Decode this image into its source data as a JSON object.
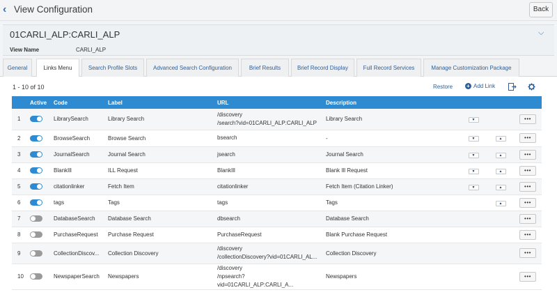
{
  "header": {
    "title": "View Configuration",
    "back_label": "Back"
  },
  "view": {
    "code": "01CARLI_ALP:CARLI_ALP",
    "name_label": "View Name",
    "name_value": "CARLI_ALP"
  },
  "tabs": [
    {
      "label": "General",
      "active": false
    },
    {
      "label": "Links Menu",
      "active": true
    },
    {
      "label": "Search Profile Slots",
      "active": false
    },
    {
      "label": "Advanced Search Configuration",
      "active": false
    },
    {
      "label": "Brief Results",
      "active": false
    },
    {
      "label": "Brief Record Display",
      "active": false
    },
    {
      "label": "Full Record Services",
      "active": false
    },
    {
      "label": "Manage Customization Package",
      "active": false
    }
  ],
  "toolbar": {
    "count": "1 - 10 of 10",
    "restore_label": "Restore",
    "add_link_label": "Add Link",
    "export_icon": "export-icon",
    "settings_icon": "gear-icon"
  },
  "table": {
    "columns": [
      "",
      "Active",
      "Code",
      "Label",
      "URL",
      "Description"
    ],
    "rows": [
      {
        "num": "1",
        "active": true,
        "code": "LibrarySearch",
        "label": "Library Search",
        "url": "/discovery\n/search?vid=01CARLI_ALP:CARLI_ALP",
        "description": "Library Search",
        "down": true,
        "up": false
      },
      {
        "num": "2",
        "active": true,
        "code": "BrowseSearch",
        "label": "Browse Search",
        "url": "bsearch",
        "description": "-",
        "down": true,
        "up": true
      },
      {
        "num": "3",
        "active": true,
        "code": "JournalSearch",
        "label": "Journal Search",
        "url": "jsearch",
        "description": "Journal Search",
        "down": true,
        "up": true
      },
      {
        "num": "4",
        "active": true,
        "code": "BlankIll",
        "label": "ILL Request",
        "url": "BlankIll",
        "description": "Blank Ill Request",
        "down": true,
        "up": true
      },
      {
        "num": "5",
        "active": true,
        "code": "citationlinker",
        "label": "Fetch Item",
        "url": "citationlinker",
        "description": "Fetch Item (Citation Linker)",
        "down": true,
        "up": true
      },
      {
        "num": "6",
        "active": true,
        "code": "tags",
        "label": "Tags",
        "url": "tags",
        "description": "Tags",
        "down": false,
        "up": true
      },
      {
        "num": "7",
        "active": false,
        "code": "DatabaseSearch",
        "label": "Database Search",
        "url": "dbsearch",
        "description": "Database Search",
        "down": false,
        "up": false
      },
      {
        "num": "8",
        "active": false,
        "code": "PurchaseRequest",
        "label": "Purchase Request",
        "url": "PurchaseRequest",
        "description": "Blank Purchase Request",
        "down": false,
        "up": false
      },
      {
        "num": "9",
        "active": false,
        "code": "CollectionDiscov...",
        "label": "Collection Discovery",
        "url": "/discovery\n/collectionDiscovery?vid=01CARLI_AL...",
        "description": "Collection Discovery",
        "down": false,
        "up": false
      },
      {
        "num": "10",
        "active": false,
        "code": "NewspaperSearch",
        "label": "Newspapers",
        "url": "/discovery\n/npsearch?vid=01CARLI_ALP:CARLI_A...",
        "description": "Newspapers",
        "down": false,
        "up": false
      }
    ],
    "more_label": "•••",
    "down_glyph": "▼",
    "up_glyph": "▲"
  },
  "colors": {
    "accent": "#2e8bd1",
    "link": "#2d5e98",
    "toggle_off": "#9a9a9a"
  }
}
